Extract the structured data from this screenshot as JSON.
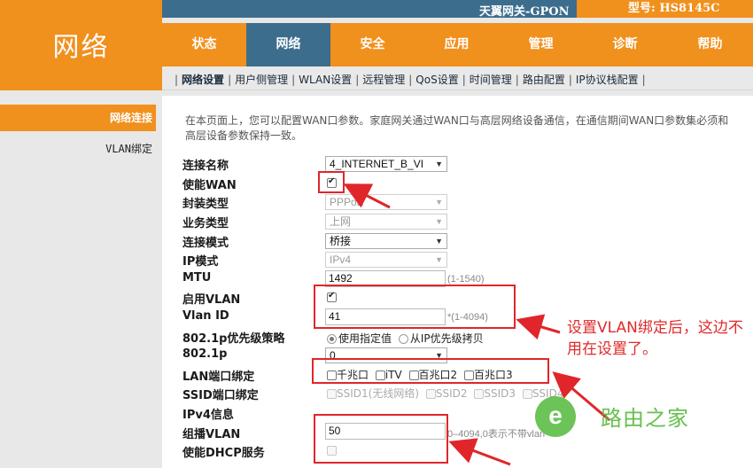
{
  "header": {
    "brand": "网络",
    "device_name": "天翼网关-GPON",
    "model": "型号: HS8145C"
  },
  "nav": {
    "items": [
      "状态",
      "网络",
      "安全",
      "应用",
      "管理",
      "诊断",
      "帮助"
    ],
    "active": "网络"
  },
  "subnav": {
    "items": [
      "网络设置",
      "用户侧管理",
      "WLAN设置",
      "远程管理",
      "QoS设置",
      "时间管理",
      "路由配置",
      "IP协议栈配置"
    ],
    "active": "网络设置"
  },
  "sidebar": {
    "items": [
      "网络连接",
      "VLAN绑定"
    ],
    "active": "网络连接"
  },
  "main": {
    "intro": "在本页面上，您可以配置WAN口参数。家庭网关通过WAN口与高层网络设备通信，在通信期间WAN口参数集必须和高层设备参数保持一致。",
    "labels": {
      "conn_name": "连接名称",
      "enable_wan": "使能WAN",
      "encap": "封装类型",
      "service": "业务类型",
      "conn_mode": "连接模式",
      "ip_mode": "IP模式",
      "mtu": "MTU",
      "enable_vlan": "启用VLAN",
      "vlan_id": "Vlan ID",
      "priority_policy": "802.1p优先级策略",
      "dot1p": "802.1p",
      "lan_bind": "LAN端口绑定",
      "ssid_bind": "SSID端口绑定",
      "ipv4_info": "IPv4信息",
      "mcast_vlan": "组播VLAN",
      "enable_dhcp": "使能DHCP服务"
    },
    "values": {
      "conn_name": "4_INTERNET_B_VI",
      "encap": "PPPoE",
      "service": "上网",
      "conn_mode": "桥接",
      "ip_mode": "IPv4",
      "mtu": "1492",
      "mtu_hint": "(1-1540)",
      "vlan_id": "41",
      "vlan_hint": "*(1-4094)",
      "priority_opt1": "使用指定值",
      "priority_opt2": "从IP优先级拷贝",
      "dot1p": "0",
      "lan_ports": [
        "千兆口",
        "iTV",
        "百兆口2",
        "百兆口3"
      ],
      "ssid_ports": [
        "SSID1(无线网络)",
        "SSID2",
        "SSID3",
        "SSID4"
      ],
      "mcast_vlan": "50",
      "mcast_hint": "0–4094,0表示不带vlan"
    }
  },
  "annotation": {
    "note": "设置VLAN绑定后，这边不用在设置了。",
    "color": "#e0262a"
  },
  "watermark": {
    "text": "路由之家",
    "color": "#5dbd45"
  },
  "colors": {
    "accent": "#f0901d",
    "nav_active": "#3d6d8d"
  }
}
